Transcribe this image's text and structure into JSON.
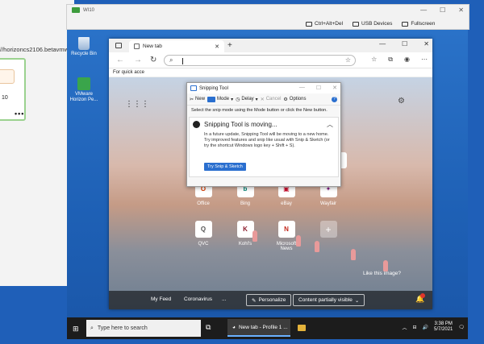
{
  "host": {
    "url_fragment": "//horizoncs2106.betavmw",
    "card_number": "10",
    "card_more": "•••"
  },
  "vm_window": {
    "title": "WI10",
    "ctrl_min": "—",
    "ctrl_max": "☐",
    "ctrl_close": "✕",
    "toolbar": {
      "ctrl_alt_del": "Ctrl+Alt+Del",
      "usb": "USB Devices",
      "fullscreen": "Fullscreen"
    }
  },
  "desktop": {
    "icons": [
      {
        "label": "Recycle Bin"
      },
      {
        "label": "VMware Horizon Pe..."
      }
    ]
  },
  "edge": {
    "tab_title": "New tab",
    "tab_close": "✕",
    "new_tab": "+",
    "win_min": "—",
    "win_max": "☐",
    "win_close": "✕",
    "nav_back": "←",
    "nav_fwd": "→",
    "nav_refresh": "↻",
    "address_value": "",
    "quick_links": "For quick acce",
    "search_icon": "⌕",
    "mic_icon": "🎤",
    "grid_icon": "⋮⋮⋮",
    "settings_icon": "⚙",
    "tiles_row1": [
      {
        "label": "Office",
        "glyph": "O",
        "color": "#d83b01"
      },
      {
        "label": "Bing",
        "glyph": "b",
        "color": "#008373"
      },
      {
        "label": "eBay",
        "glyph": "▣",
        "color": "#c8102e"
      },
      {
        "label": "Wayfair",
        "glyph": "✦",
        "color": "#7f187f"
      }
    ],
    "tiles_row2": [
      {
        "label": "QVC",
        "glyph": "Q",
        "color": "#555555"
      },
      {
        "label": "Kohl's",
        "glyph": "K",
        "color": "#8d1b2b"
      },
      {
        "label": "Microsoft News",
        "glyph": "N",
        "color": "#c4281b"
      },
      {
        "label": "",
        "glyph": "+",
        "color": "#ffffff"
      }
    ],
    "like_image": "Like this image?",
    "bottom": {
      "my_feed": "My Feed",
      "coronavirus": "Coronavirus",
      "more": "...",
      "personalize": "Personalize",
      "content_visibility": "Content partially visible",
      "bell": "🔔"
    }
  },
  "snipping_tool": {
    "title": "Snipping Tool",
    "ctrl_min": "—",
    "ctrl_max": "☐",
    "ctrl_close": "✕",
    "toolbar": {
      "new": "New",
      "mode": "Mode",
      "delay": "Delay",
      "cancel": "Cancel",
      "options": "Options",
      "help": "?"
    },
    "instruction": "Select the snip mode using the Mode button or click the New button.",
    "notice_title": "Snipping Tool is moving...",
    "notice_body": "In a future update, Snipping Tool will be moving to a new home. Try improved features and snip like usual with Snip & Sketch (or try the shortcut Windows logo key + Shift + S).",
    "try_button": "Try Snip & Sketch",
    "chevron": "︿"
  },
  "taskbar": {
    "start": "⊞",
    "search_placeholder": "Type here to search",
    "task_view": "⧉",
    "app_label": "New tab - Profile 1 ...",
    "time": "3:38 PM",
    "date": "5/7/2021",
    "tray_up": "︿",
    "network": "⊟",
    "volume": "🔊",
    "notifications": "🗨"
  }
}
